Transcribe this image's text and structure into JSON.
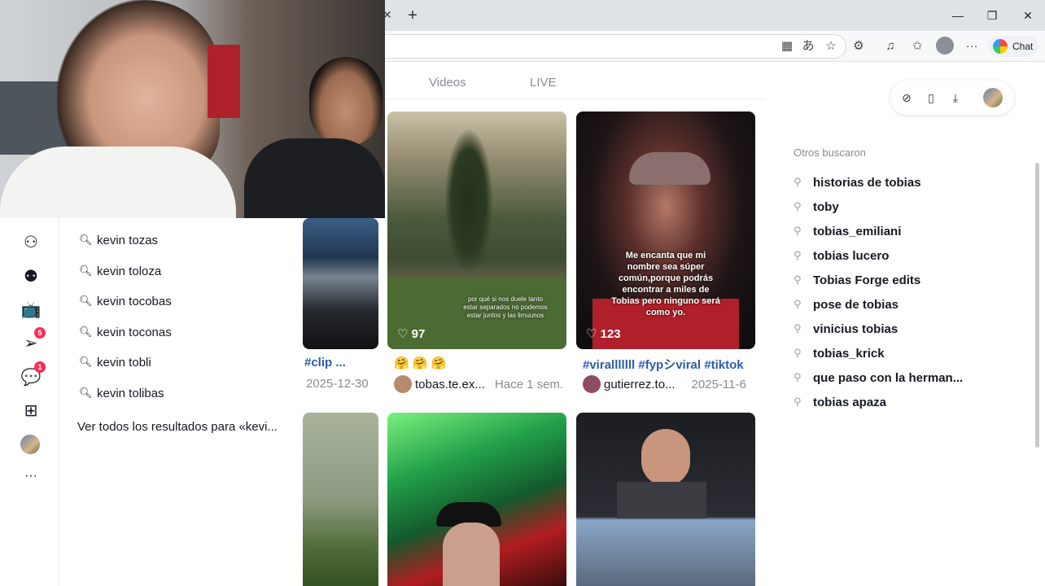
{
  "browser": {
    "new_tab": "+",
    "tab_close": "✕",
    "chat_label": "Chat",
    "window_controls": [
      "—",
      "❐",
      "✕"
    ]
  },
  "tabs": [
    {
      "label": "Videos"
    },
    {
      "label": "LIVE"
    }
  ],
  "otros": {
    "title": "Otros buscaron",
    "items": [
      "historias de tobias",
      "toby",
      "tobias_emiliani",
      "tobias lucero",
      "Tobias Forge edits",
      "pose de tobias",
      "vinicius tobias",
      "tobias_krick",
      "que paso con la herman...",
      "tobias apaza"
    ]
  },
  "sidebar": {
    "badges": {
      "inbox": "5",
      "messages": "1"
    },
    "more": "···"
  },
  "suggestions": {
    "items": [
      "kevin tozas",
      "kevin toloza",
      "kevin tocobas",
      "kevin toconas",
      "kevin tobli",
      "kevin tolibas"
    ],
    "see_all": "Ver todos los resultados para «kevi..."
  },
  "videos": [
    {
      "caption": "#clip ...",
      "date": "2025-12-30"
    },
    {
      "likes": "97",
      "overlay": "por qué si nos duele tanto estar separados no podemos estar juntos y las limuunos",
      "caption": "🤗 🤗 🤗",
      "author": "tobas.te.ex...",
      "date": "Hace 1 sem."
    },
    {
      "likes": "123",
      "overlay": "Me encanta que mi nombre sea súper común,porque podrás encontrar a miles de Tobias pero ninguno será como yo.",
      "caption": "#viralllllll #fypシviral #tiktok",
      "author": "gutierrez.to...",
      "date": "2025-11-6"
    }
  ],
  "colors": {
    "accent": "#fe2c55",
    "hashtag": "#2b5cab"
  }
}
